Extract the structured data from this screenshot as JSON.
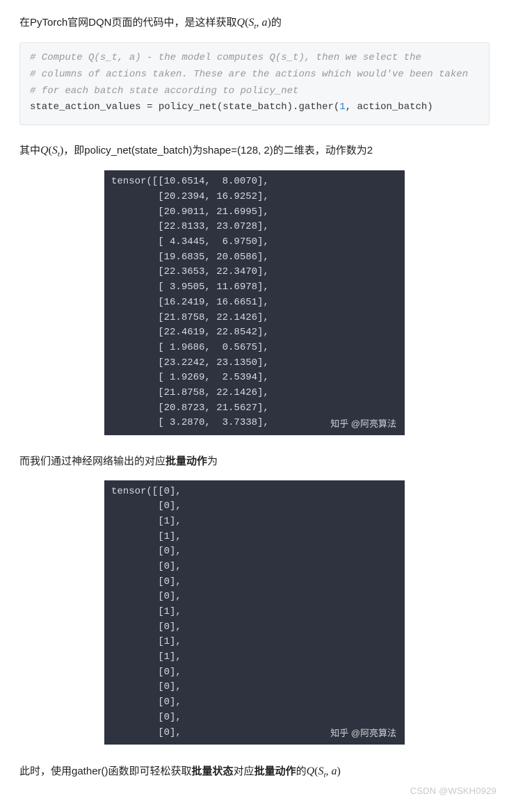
{
  "para1_pre": "在PyTorch官网DQN页面的代码中，是这样获取",
  "math_qsta": "Q(Sₜ, a)",
  "para1_post": "的",
  "code1": {
    "c1": "# Compute Q(s_t, a) - the model computes Q(s_t), then we select the",
    "c2": "# columns of actions taken. These are the actions which would've been taken",
    "c3": "# for each batch state according to policy_net",
    "line_pre": "state_action_values = policy_net(state_batch).gather(",
    "num": "1",
    "line_post": ", action_batch)"
  },
  "para2_pre": "其中",
  "math_qst": "Q(Sₜ)",
  "para2_post": "，即policy_net(state_batch)为shape=(128, 2)的二维表，动作数为2",
  "tensor1_text": "tensor([[10.6514,  8.0070],\n        [20.2394, 16.9252],\n        [20.9011, 21.6995],\n        [22.8133, 23.0728],\n        [ 4.3445,  6.9750],\n        [19.6835, 20.0586],\n        [22.3653, 22.3470],\n        [ 3.9505, 11.6978],\n        [16.2419, 16.6651],\n        [21.8758, 22.1426],\n        [22.4619, 22.8542],\n        [ 1.9686,  0.5675],\n        [23.2242, 23.1350],\n        [ 1.9269,  2.5394],\n        [21.8758, 22.1426],\n        [20.8723, 21.5627],\n        [ 3.2870,  3.7338],",
  "watermark1": "知乎 @阿亮算法",
  "para3_pre": "而我们通过神经网络输出的对应",
  "bold3": "批量动作",
  "para3_post": "为",
  "tensor2_text": "tensor([[0],\n        [0],\n        [1],\n        [1],\n        [0],\n        [0],\n        [0],\n        [0],\n        [1],\n        [0],\n        [1],\n        [1],\n        [0],\n        [0],\n        [0],\n        [0],\n        [0],",
  "watermark2": "知乎 @阿亮算法",
  "para4_pre": "此时，使用gather()函数即可轻松获取",
  "bold4a": "批量状态",
  "para4_mid": "对应",
  "bold4b": "批量动作",
  "para4_post1": "的",
  "csdn": "CSDN @WSKH0929"
}
